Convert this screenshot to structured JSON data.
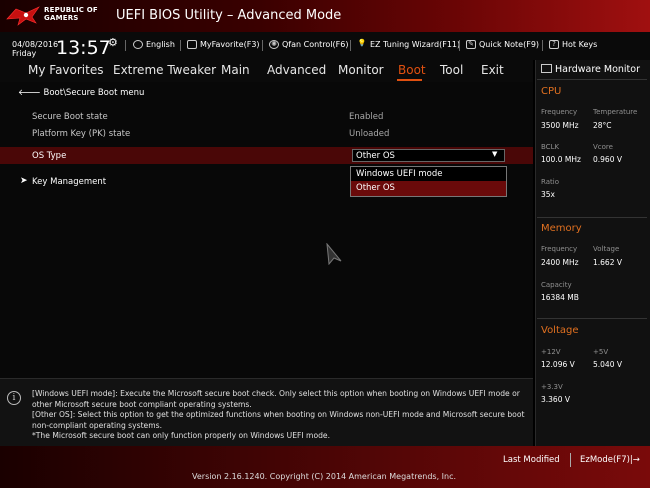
{
  "header": {
    "logo_line1": "REPUBLIC OF",
    "logo_line2": "GAMERS",
    "title": "UEFI BIOS Utility – Advanced Mode"
  },
  "toolbar": {
    "date": "04/08/2016",
    "day": "Friday",
    "time": "13:57",
    "items": [
      {
        "label": "English",
        "icon": "globe-icon"
      },
      {
        "label": "MyFavorite(F3)",
        "icon": "favorite-icon"
      },
      {
        "label": "Qfan Control(F6)",
        "icon": "fan-icon"
      },
      {
        "label": "EZ Tuning Wizard(F11)",
        "icon": "wizard-icon"
      },
      {
        "label": "Quick Note(F9)",
        "icon": "note-icon"
      },
      {
        "label": "Hot Keys",
        "icon": "help-icon"
      }
    ]
  },
  "menu": {
    "tabs": [
      "My Favorites",
      "Extreme Tweaker",
      "Main",
      "Advanced",
      "Monitor",
      "Boot",
      "Tool",
      "Exit"
    ],
    "active": "Boot"
  },
  "page": {
    "breadcrumb": "Boot\\Secure Boot menu",
    "rows": [
      {
        "label": "Secure Boot state",
        "value": "Enabled"
      },
      {
        "label": "Platform Key (PK) state",
        "value": "Unloaded"
      }
    ],
    "os_type": {
      "label": "OS Type",
      "selected": "Other OS",
      "options": [
        "Windows UEFI mode",
        "Other OS"
      ]
    },
    "key_management": "Key Management"
  },
  "help": {
    "lines": [
      "[Windows UEFI mode]: Execute the Microsoft secure boot check. Only select this option when booting on Windows UEFI mode or",
      "other Microsoft secure boot compliant operating systems.",
      "[Other OS]: Select this option to get the optimized functions when booting on Windows non-UEFI mode and Microsoft secure boot",
      "non-compliant operating systems.",
      "*The Microsoft secure boot can only function properly on Windows UEFI mode."
    ]
  },
  "hardware_monitor": {
    "title": "Hardware Monitor",
    "cpu": {
      "section": "CPU",
      "frequency_label": "Frequency",
      "frequency": "3500 MHz",
      "temperature_label": "Temperature",
      "temperature": "28°C",
      "bclk_label": "BCLK",
      "bclk": "100.0 MHz",
      "vcore_label": "Vcore",
      "vcore": "0.960 V",
      "ratio_label": "Ratio",
      "ratio": "35x"
    },
    "memory": {
      "section": "Memory",
      "frequency_label": "Frequency",
      "frequency": "2400 MHz",
      "voltage_label": "Voltage",
      "voltage": "1.662 V",
      "capacity_label": "Capacity",
      "capacity": "16384 MB"
    },
    "voltage": {
      "section": "Voltage",
      "v12_label": "+12V",
      "v12": "12.096 V",
      "v5_label": "+5V",
      "v5": "5.040 V",
      "v33_label": "+3.3V",
      "v33": "3.360 V"
    }
  },
  "footer": {
    "last_modified": "Last Modified",
    "ezmode": "EzMode(F7)|→",
    "version": "Version 2.16.1240. Copyright (C) 2014 American Megatrends, Inc."
  },
  "colors": {
    "accent": "#e05010",
    "selected_row": "#4a0707",
    "section_heading": "#e07020"
  }
}
